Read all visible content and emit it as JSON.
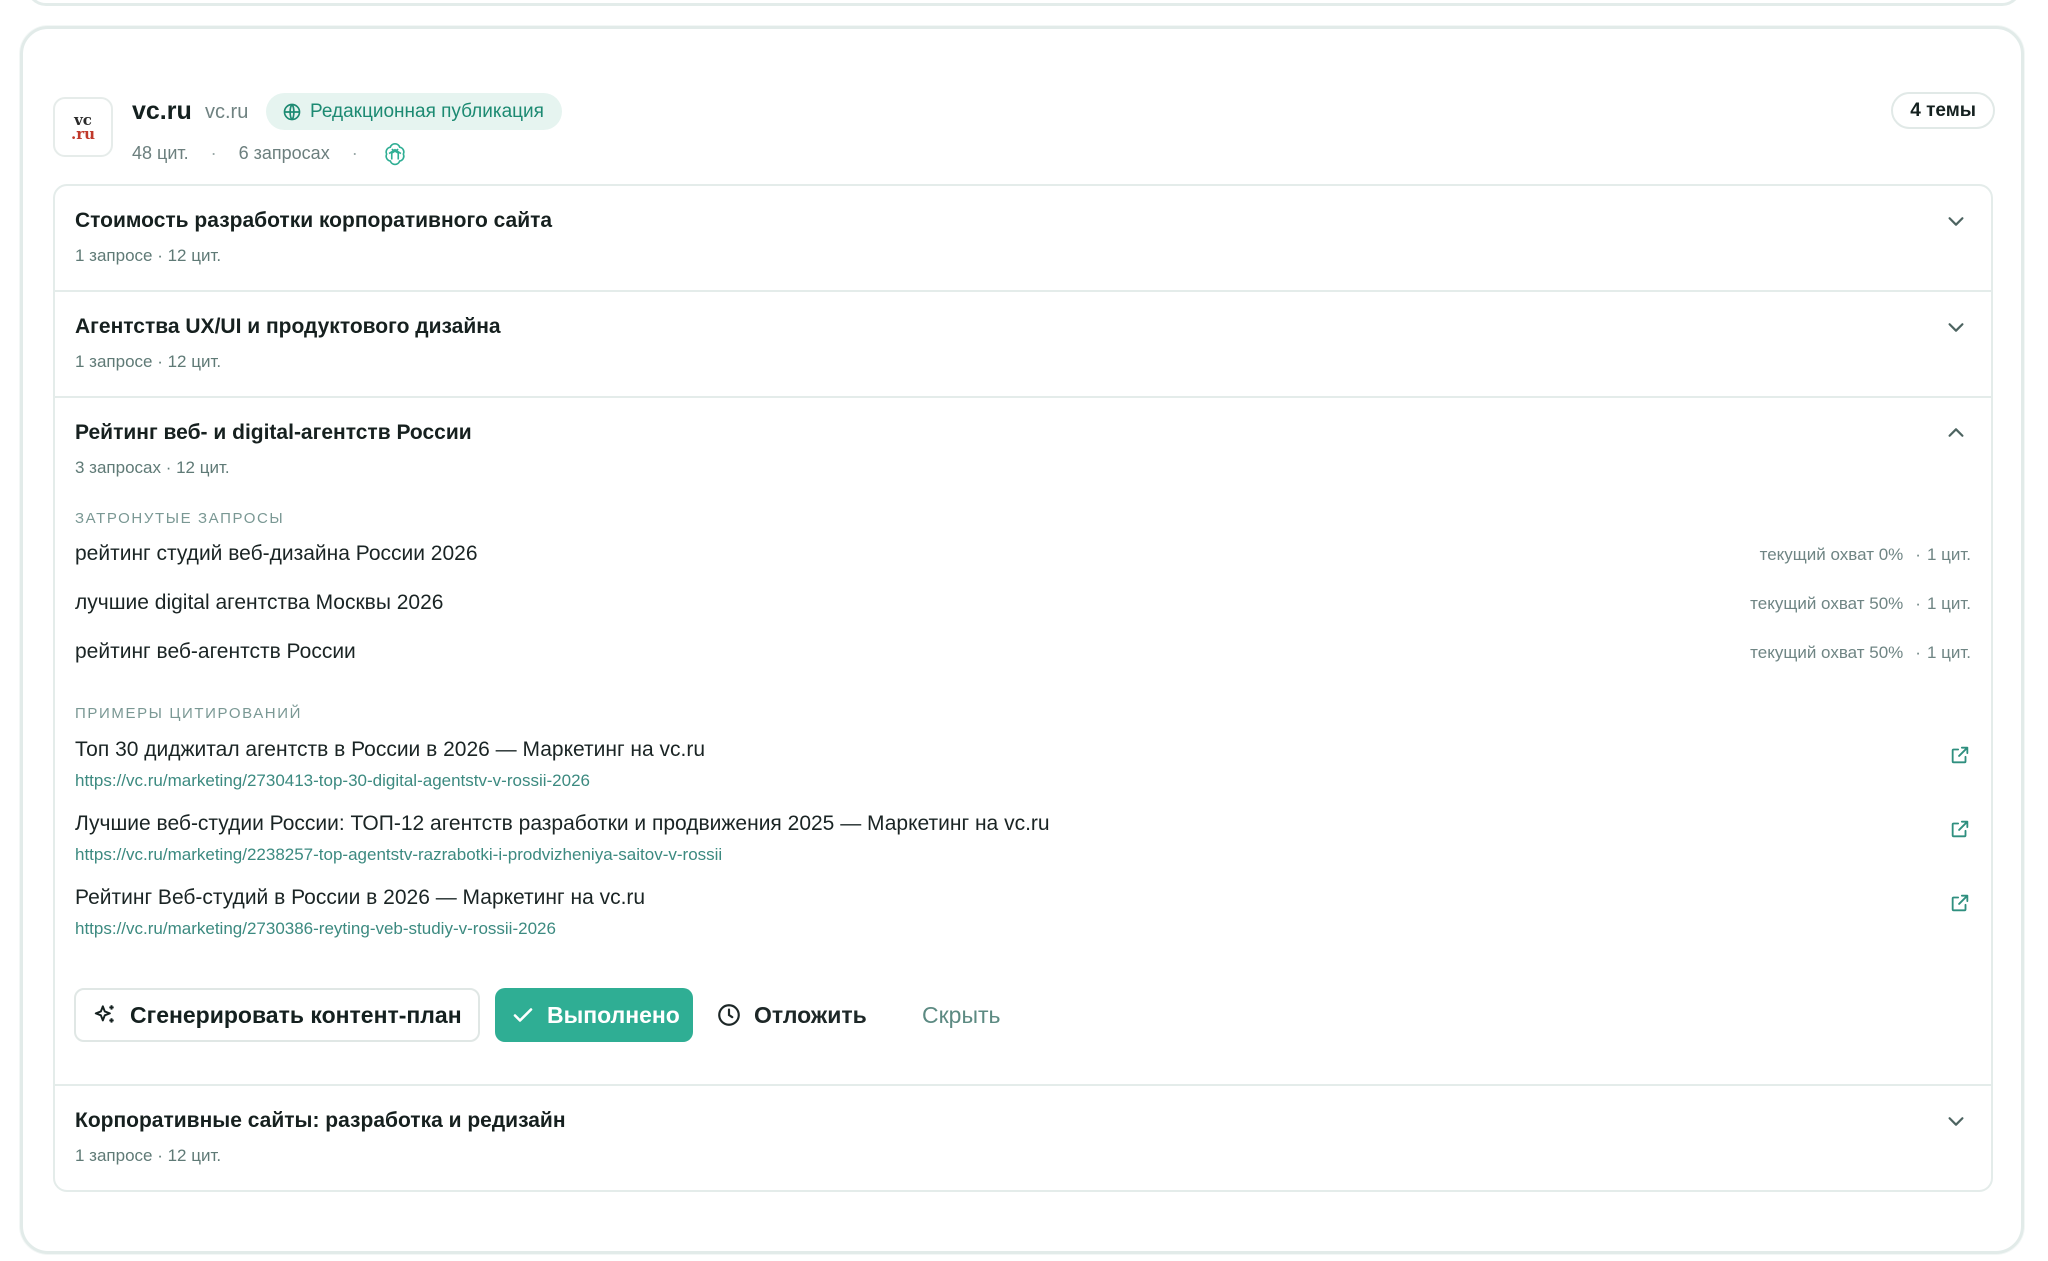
{
  "header": {
    "logo_text_top": "vc",
    "logo_text_bottom": ".ru",
    "site_name": "vc.ru",
    "site_domain": "vc.ru",
    "badge_label": "Редакционная публикация",
    "citations": "48 цит.",
    "queries": "6 запросах",
    "topics_count": "4 темы",
    "accent_color": "#2fae94"
  },
  "topics": [
    {
      "title": "Стоимость разработки корпоративного сайта",
      "meta": "1 запросе · 12 цит.",
      "expanded": false
    },
    {
      "title": "Агентства UX/UI и продуктового дизайна",
      "meta": "1 запросе · 12 цит.",
      "expanded": false
    },
    {
      "title": "Рейтинг веб- и digital-агентств России",
      "meta": "3 запросах · 12 цит.",
      "expanded": true,
      "queries_label": "ЗАТРОНУТЫЕ ЗАПРОСЫ",
      "queries": [
        {
          "text": "рейтинг студий веб-дизайна России 2026",
          "coverage": "текущий охват 0%",
          "cites": "1 цит."
        },
        {
          "text": "лучшие digital агентства Москвы 2026",
          "coverage": "текущий охват 50%",
          "cites": "1 цит."
        },
        {
          "text": "рейтинг веб-агентств России",
          "coverage": "текущий охват 50%",
          "cites": "1 цит."
        }
      ],
      "citations_label": "ПРИМЕРЫ ЦИТИРОВАНИЙ",
      "citations": [
        {
          "title": "Топ 30 диджитал агентств в России в 2026 — Маркетинг на vc.ru",
          "url": "https://vc.ru/marketing/2730413-top-30-digital-agentstv-v-rossii-2026"
        },
        {
          "title": "Лучшие веб-студии России: ТОП-12 агентств разработки и продвижения 2025 — Маркетинг на vc.ru",
          "url": "https://vc.ru/marketing/2238257-top-agentstv-razrabotki-i-prodvizheniya-saitov-v-rossii"
        },
        {
          "title": "Рейтинг Веб-студий в России в 2026 — Маркетинг на vc.ru",
          "url": "https://vc.ru/marketing/2730386-reyting-veb-studiy-v-rossii-2026"
        }
      ],
      "actions": {
        "generate": "Сгенерировать контент-план",
        "done": "Выполнено",
        "later": "Отложить",
        "hide": "Скрыть"
      }
    },
    {
      "title": "Корпоративные сайты: разработка и редизайн",
      "meta": "1 запросе · 12 цит.",
      "expanded": false
    }
  ],
  "icons": {
    "globe": "globe-icon",
    "ai_model": "openai-logo-icon",
    "chevron_down": "chevron-down-icon",
    "chevron_up": "chevron-up-icon",
    "external": "external-link-icon",
    "sparkles": "sparkles-icon",
    "check": "check-icon",
    "clock": "clock-icon"
  }
}
